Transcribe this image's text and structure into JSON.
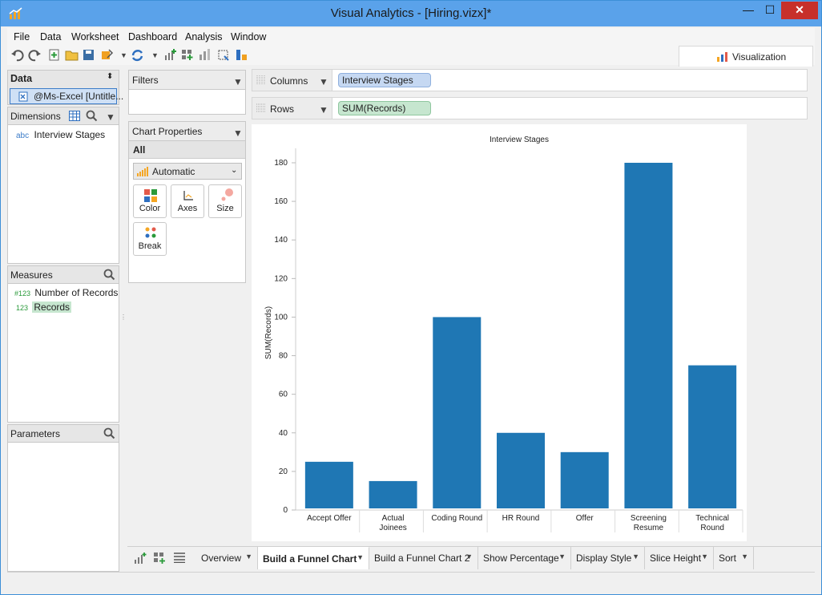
{
  "window": {
    "title": "Visual Analytics - [Hiring.vizx]*",
    "minimize": "—",
    "maximize": "☐",
    "close": "✕"
  },
  "menu": [
    "File",
    "Data",
    "Worksheet",
    "Dashboard",
    "Analysis",
    "Window"
  ],
  "visualization_tab": "Visualization",
  "data_panel": {
    "title": "Data",
    "source": "@Ms-Excel [Untitle...",
    "dimensions_label": "Dimensions",
    "dimensions": [
      {
        "type": "abc",
        "name": "Interview Stages"
      }
    ],
    "measures_label": "Measures",
    "measures": [
      {
        "type": "#123",
        "name": "Number of Records"
      },
      {
        "type": "123",
        "name": "Records"
      }
    ],
    "parameters_label": "Parameters"
  },
  "filters_label": "Filters",
  "chart_properties": {
    "title": "Chart Properties",
    "all_label": "All",
    "mark_type": "Automatic",
    "buttons": [
      "Color",
      "Axes",
      "Size",
      "Break"
    ]
  },
  "shelves": {
    "columns_label": "Columns",
    "columns_pill": "Interview Stages",
    "rows_label": "Rows",
    "rows_pill": "SUM(Records)"
  },
  "chart_data": {
    "type": "bar",
    "title": "Interview Stages",
    "ylabel": "SUM(Records)",
    "xlabel": "",
    "categories": [
      "Accept Offer",
      "Actual Joinees",
      "Coding Round",
      "HR Round",
      "Offer",
      "Screening Resume",
      "Technical Round"
    ],
    "values": [
      25,
      15,
      100,
      40,
      30,
      180,
      75
    ],
    "ylim": [
      0,
      180
    ],
    "yticks": [
      0,
      20,
      40,
      60,
      80,
      100,
      120,
      140,
      160,
      180
    ],
    "bar_color": "#1f77b4",
    "grid": false
  },
  "sheet_tabs": [
    {
      "label": "Overview",
      "active": false
    },
    {
      "label": "Build a Funnel Chart",
      "active": true
    },
    {
      "label": "Build a Funnel Chart 2",
      "active": false
    },
    {
      "label": "Show Percentage",
      "active": false
    },
    {
      "label": "Display Style",
      "active": false
    },
    {
      "label": "Slice Height",
      "active": false
    },
    {
      "label": "Sort",
      "active": false
    }
  ],
  "colors": {
    "titlebar": "#5aa2ea",
    "columns_pill": "#c5d8f2",
    "rows_pill": "#c6e6cf",
    "selected_measure": "#c6e6cf"
  }
}
